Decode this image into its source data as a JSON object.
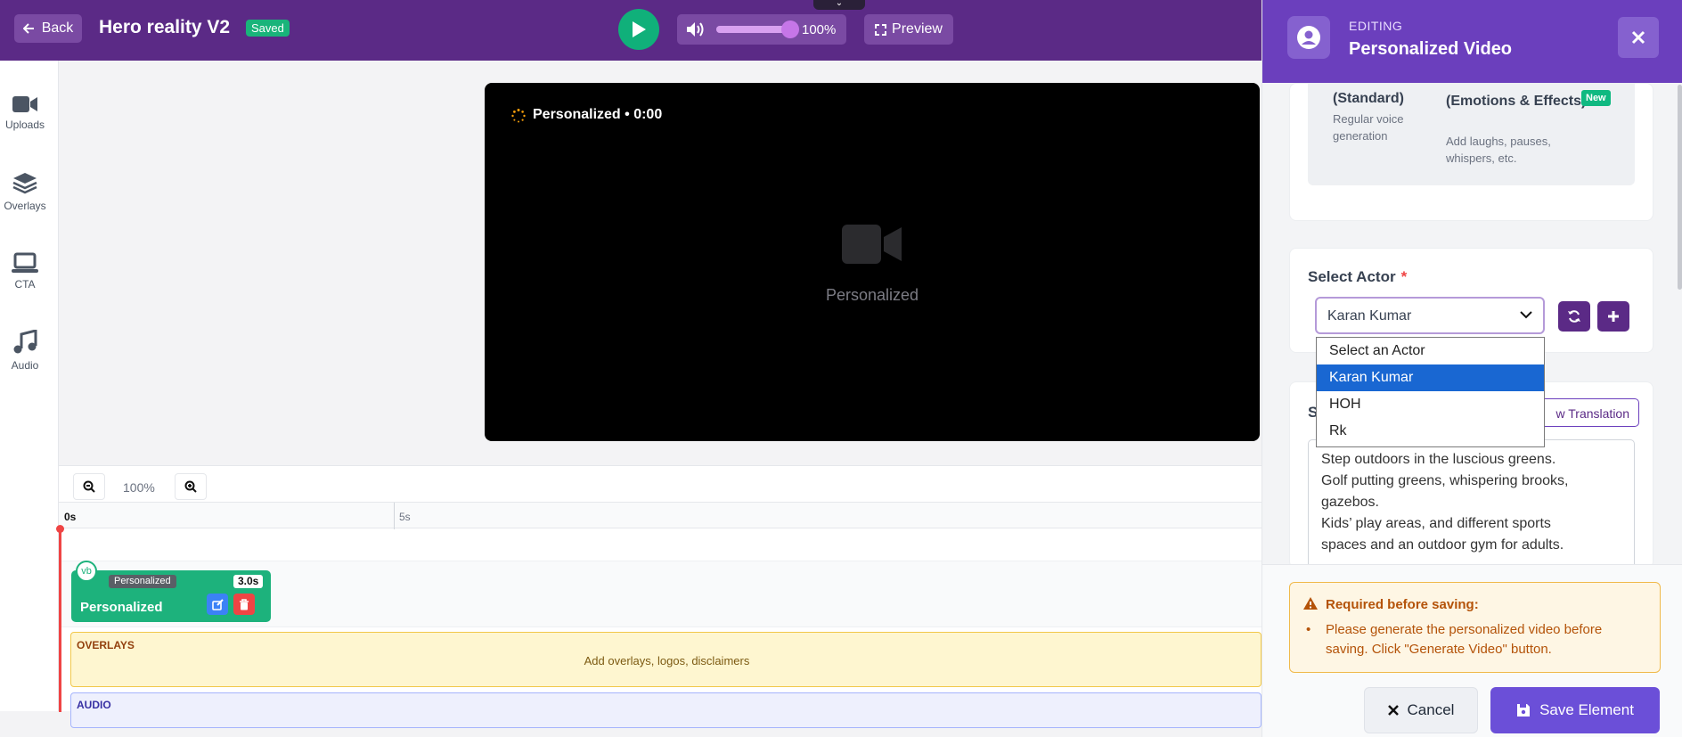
{
  "topbar": {
    "back_label": "Back",
    "title": "Hero reality V2",
    "saved_badge": "Saved",
    "volume_percent": "100%",
    "volume_level": 1.0,
    "preview_label": "Preview"
  },
  "sidebar": {
    "items": [
      {
        "label": "Uploads",
        "icon": "video-camera-icon"
      },
      {
        "label": "Overlays",
        "icon": "layers-icon"
      },
      {
        "label": "CTA",
        "icon": "laptop-icon"
      },
      {
        "label": "Audio",
        "icon": "music-note-icon"
      }
    ]
  },
  "player": {
    "status_label": "Personalized • 0:00",
    "placeholder_label": "Personalized"
  },
  "timeline": {
    "zoom_percent": "100%",
    "ruler": [
      "0s",
      "5s"
    ],
    "clip": {
      "tag": "Personalized",
      "duration": "3.0s",
      "title": "Personalized",
      "circle_text": "vb"
    },
    "overlays": {
      "title": "OVERLAYS",
      "hint": "Add overlays, logos, disclaimers"
    },
    "audio": {
      "title": "AUDIO"
    }
  },
  "panel": {
    "header_small": "EDITING",
    "header_title": "Personalized Video",
    "voice_options": [
      {
        "title": "(Standard)",
        "desc": "Regular voice generation"
      },
      {
        "title": "(Emotions & Effects)",
        "desc": "Add laughs, pauses, whispers, etc.",
        "badge": "New"
      }
    ],
    "actor": {
      "label": "Select Actor",
      "required_mark": "*",
      "selected": "Karan Kumar",
      "options": [
        "Select an Actor",
        "Karan Kumar",
        "HOH",
        "Rk"
      ]
    },
    "script": {
      "label_visible": "S",
      "translation_btn": "w Translation",
      "text_lines": [
        "Step outdoors in the luscious greens.",
        "Golf putting greens, whispering brooks,",
        "gazebos.",
        "Kids’ play areas, and different sports",
        "spaces and an outdoor gym for adults."
      ]
    },
    "warning": {
      "title": "Required before saving:",
      "items": [
        "Please generate the personalized video before saving. Click \"Generate Video\" button."
      ]
    },
    "cancel_label": "Cancel",
    "save_label": "Save Element"
  },
  "colors": {
    "topbar": "#5b2a86",
    "panel_header": "#6b3fbd",
    "accent_green": "#1db27c",
    "save_button": "#6b4fd8",
    "warning": "#b45309"
  }
}
